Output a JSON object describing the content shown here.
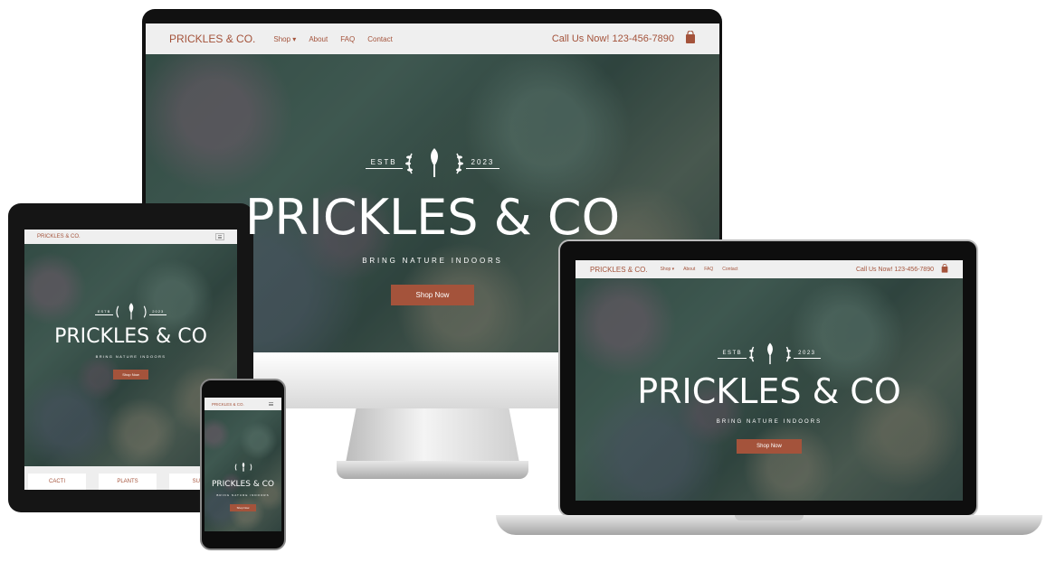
{
  "site": {
    "brand": "PRICKLES & CO.",
    "nav": [
      "Shop",
      "About",
      "FAQ",
      "Contact"
    ],
    "phone": "Call Us Now! 123-456-7890",
    "estb_left": "ESTB",
    "estb_right": "2023",
    "hero_title": "PRICKLES & CO",
    "tagline": "BRING NATURE INDOORS",
    "cta": "Shop Now",
    "categories": [
      "CACTI",
      "PLANTS",
      "SUC"
    ]
  },
  "icons": {
    "cart": "shopping-bag-icon",
    "menu": "hamburger-menu-icon",
    "logo": "shovel-laurel-logo"
  },
  "colors": {
    "accent": "#a4533b",
    "navbar_bg": "#efefef",
    "hero_text": "#ffffff"
  }
}
